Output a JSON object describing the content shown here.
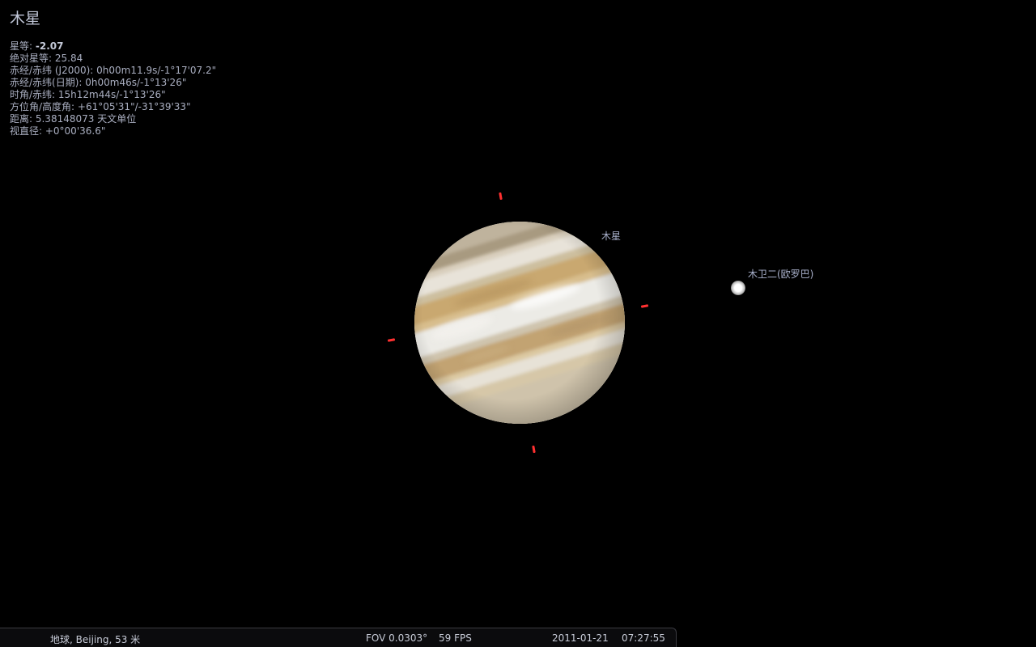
{
  "object_info": {
    "title": "木星",
    "magnitude_label": "星等: ",
    "magnitude_value": "-2.07",
    "lines": [
      "绝对星等: 25.84",
      "赤经/赤纬 (J2000): 0h00m11.9s/-1°17'07.2\"",
      "赤经/赤纬(日期): 0h00m46s/-1°13'26\"",
      "时角/赤纬: 15h12m44s/-1°13'26\"",
      "方位角/高度角: +61°05'31\"/-31°39'33\"",
      "距离: 5.38148073 天文单位",
      "视直径: +0°00'36.6\""
    ]
  },
  "sky": {
    "planet_label": "木星",
    "moon_label": "木卫二(欧罗巴)"
  },
  "status_bar": {
    "location": "地球, Beijing, 53 米",
    "fov": "FOV 0.0303°",
    "fps": "59 FPS",
    "date": "2011-01-21",
    "time": "07:27:55"
  },
  "colors": {
    "background": "#000000",
    "info_text": "#a9aec0",
    "selection_marker": "#ff3030"
  }
}
